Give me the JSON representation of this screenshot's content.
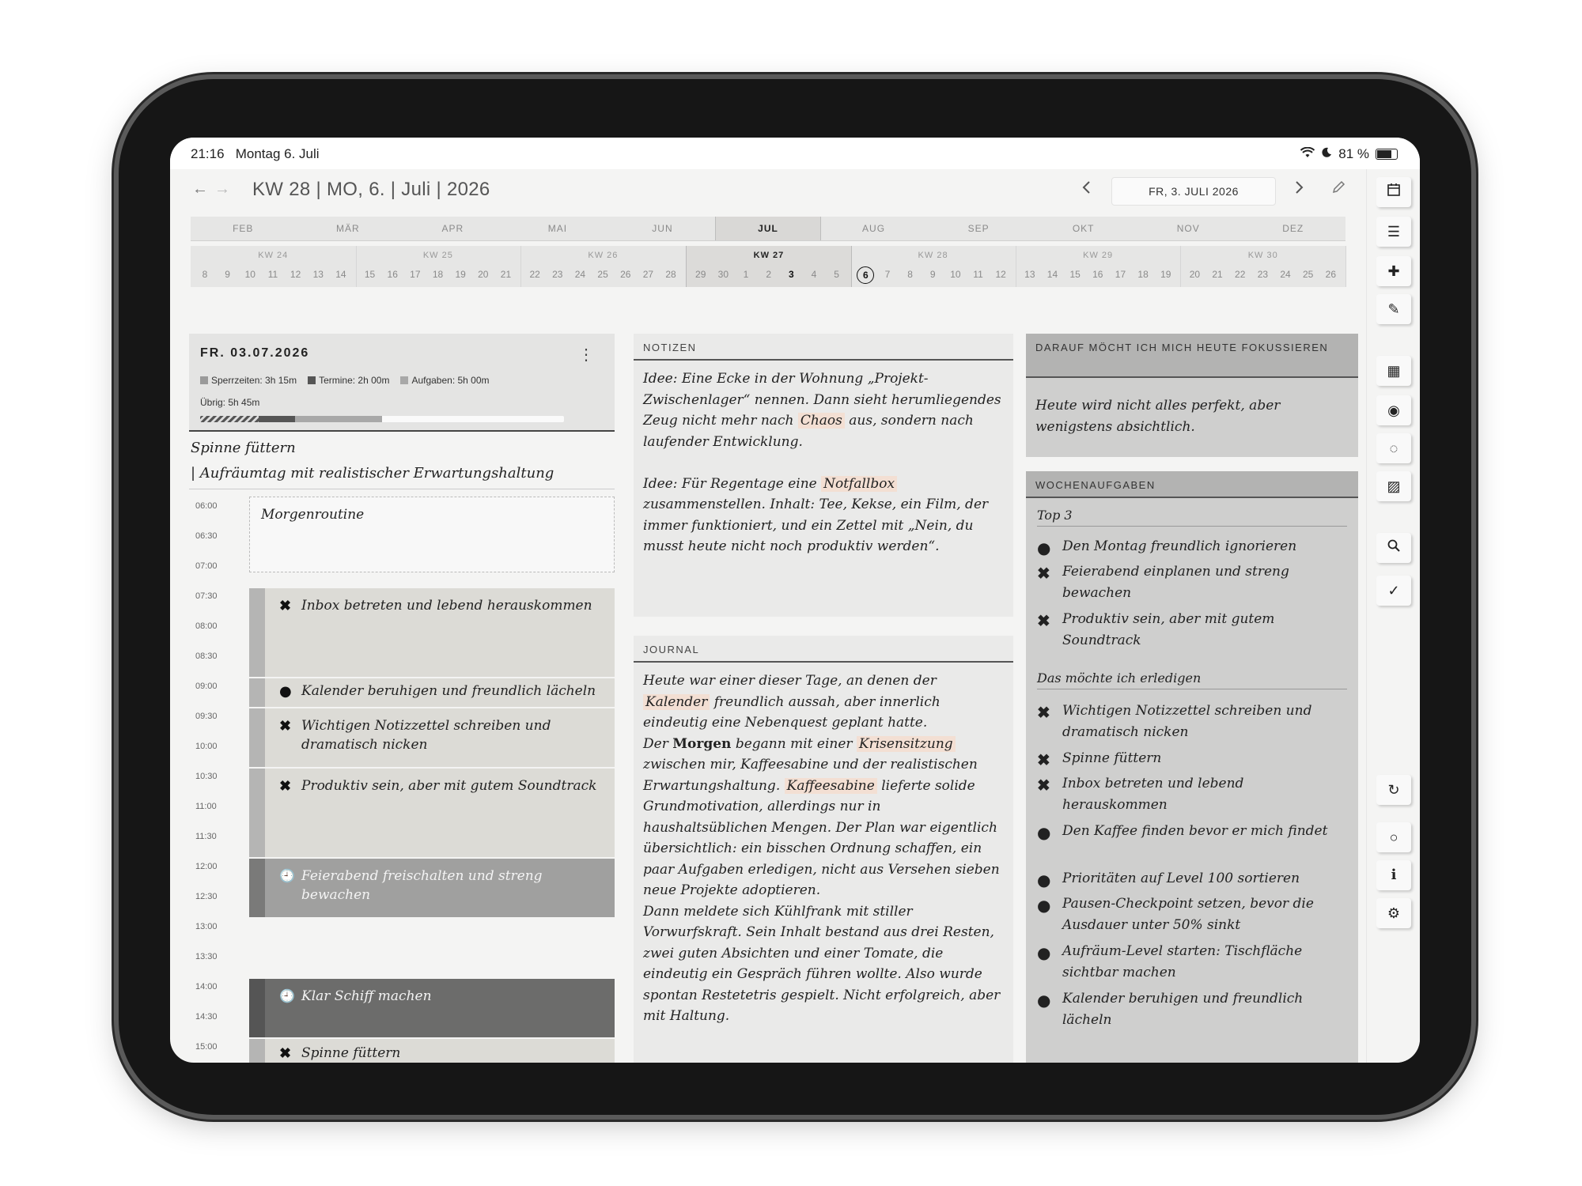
{
  "status": {
    "time": "21:16",
    "date": "Montag 6. Juli",
    "battery": "81 %"
  },
  "header": {
    "title": "KW 28 | MO, 6. | Juli | 2026",
    "selected_date": "FR, 3. JULI 2026"
  },
  "months": [
    {
      "label": "FEB"
    },
    {
      "label": "MÄR"
    },
    {
      "label": "APR"
    },
    {
      "label": "MAI"
    },
    {
      "label": "JUN"
    },
    {
      "label": "JUL",
      "active": true
    },
    {
      "label": "AUG"
    },
    {
      "label": "SEP"
    },
    {
      "label": "OKT"
    },
    {
      "label": "NOV"
    },
    {
      "label": "DEZ"
    }
  ],
  "weeks": [
    {
      "label": "KW 24",
      "days": [
        "8",
        "9",
        "10",
        "11",
        "12",
        "13",
        "14"
      ]
    },
    {
      "label": "KW 25",
      "days": [
        "15",
        "16",
        "17",
        "18",
        "19",
        "20",
        "21"
      ]
    },
    {
      "label": "KW 26",
      "days": [
        "22",
        "23",
        "24",
        "25",
        "26",
        "27",
        "28"
      ]
    },
    {
      "label": "KW 27",
      "active": true,
      "days": [
        "29",
        "30",
        "1",
        "2",
        "3",
        "4",
        "5"
      ]
    },
    {
      "label": "KW 28",
      "days": [
        "6",
        "7",
        "8",
        "9",
        "10",
        "11",
        "12"
      ]
    },
    {
      "label": "KW 29",
      "days": [
        "13",
        "14",
        "15",
        "16",
        "17",
        "18",
        "19"
      ]
    },
    {
      "label": "KW 30",
      "days": [
        "20",
        "21",
        "22",
        "23",
        "24",
        "25",
        "26"
      ]
    }
  ],
  "calendar_marks": {
    "selected_day": "3",
    "today": "6"
  },
  "daycard": {
    "date": "FR. 03.07.2026",
    "legend": [
      {
        "label": "Sperrzeiten: 3h 15m",
        "color": "#9a9a9a"
      },
      {
        "label": "Termine: 2h 00m",
        "color": "#555555"
      },
      {
        "label": "Aufgaben: 5h 00m",
        "color": "#a8a8a8"
      }
    ],
    "remaining": "Übrig: 5h 45m"
  },
  "headlines": [
    "Spinne füttern",
    "| Aufräumtag mit realistischer Erwartungshaltung"
  ],
  "times": [
    "06:00",
    "06:30",
    "07:00",
    "07:30",
    "08:00",
    "08:30",
    "09:00",
    "09:30",
    "10:00",
    "10:30",
    "11:00",
    "11:30",
    "12:00",
    "12:30",
    "13:00",
    "13:30",
    "14:00",
    "14:30",
    "15:00"
  ],
  "schedule": [
    {
      "text": "Morgenroutine"
    },
    {
      "mark": "✖",
      "text": "Inbox betreten und lebend herauskommen"
    },
    {
      "mark": "●",
      "text": "Kalender beruhigen und freundlich lächeln"
    },
    {
      "mark": "✖",
      "text": "Wichtigen Notizzettel schreiben und dramatisch nicken"
    },
    {
      "mark": "✖",
      "text": "Produktiv sein, aber mit gutem Soundtrack"
    },
    {
      "mark": "🕘",
      "text": "Feierabend freischalten und streng bewachen"
    },
    {
      "mark": "🕘",
      "text": "Klar Schiff machen"
    },
    {
      "mark": "✖",
      "text": "Spinne füttern"
    }
  ],
  "notes": {
    "header": "NOTIZEN",
    "p1": {
      "a": "Idee: Eine Ecke in der Wohnung „Projekt-Zwischenlager“ nennen. Dann sieht herumliegendes Zeug nicht mehr nach ",
      "hl": "Chaos",
      "b": " aus, sondern nach laufender Entwicklung."
    },
    "p2": {
      "a": "Idee: Für Regentage eine ",
      "hl": "Notfallbox",
      "b": " zusammenstellen. Inhalt: Tee, Kekse, ein Film, der immer funktioniert, und ein Zettel mit „Nein, du musst heute nicht noch produktiv werden“."
    }
  },
  "journal": {
    "header": "JOURNAL",
    "s1": "Heute war einer dieser Tage, an denen der ",
    "h1": "Kalender",
    "s2": " freundlich aussah, aber innerlich eindeutig eine Nebenquest geplant hatte.",
    "s3": "Der ",
    "b1": "Morgen",
    "s4": " begann mit einer ",
    "h2": "Krisensitzung",
    "s5": " zwischen mir, Kaffeesabine und der realistischen Erwartungshaltung. ",
    "h3": "Kaffeesabine",
    "s6": " lieferte solide Grundmotivation, allerdings nur in haushaltsüblichen Mengen. Der Plan war eigentlich übersichtlich: ein bisschen Ordnung schaffen, ein paar Aufgaben erledigen, nicht aus Versehen sieben neue Projekte adoptieren.",
    "s7": "Dann meldete sich Kühlfrank mit stiller Vorwurfskraft. Sein Inhalt bestand aus drei Resten, zwei guten Absichten und einer Tomate, die eindeutig ein Gespräch führen wollte. Also wurde spontan Restetetris gespielt. Nicht erfolgreich, aber mit Haltung."
  },
  "focus": {
    "header": "DARAUF MÖCHT ICH MICH HEUTE FOKUSSIEREN",
    "text": "Heute wird nicht alles perfekt, aber wenigstens absichtlich."
  },
  "weekly": {
    "header": "WOCHENAUFGABEN",
    "top_label": "Top 3",
    "top": [
      {
        "mark": "●",
        "text": "Den Montag freundlich ignorieren"
      },
      {
        "mark": "✖",
        "text": "Feierabend einplanen und streng bewachen"
      },
      {
        "mark": "✖",
        "text": "Produktiv sein, aber mit gutem Soundtrack"
      }
    ],
    "todo_label": "Das möchte ich erledigen",
    "todo": [
      {
        "mark": "✖",
        "text": "Wichtigen Notizzettel schreiben und dramatisch nicken"
      },
      {
        "mark": "✖",
        "text": "Spinne füttern"
      },
      {
        "mark": "✖",
        "text": "Inbox betreten und lebend herauskommen"
      },
      {
        "mark": "●",
        "text": "Den Kaffee finden bevor er mich findet"
      },
      {
        "mark": "●",
        "text": "Prioritäten auf Level 100 sortieren"
      },
      {
        "mark": "●",
        "text": "Pausen-Checkpoint setzen, bevor die Ausdauer unter 50% sinkt"
      },
      {
        "mark": "●",
        "text": "Aufräum-Level starten: Tischfläche sichtbar machen"
      },
      {
        "mark": "●",
        "text": "Kalender beruhigen und freundlich lächeln"
      }
    ]
  },
  "progress": {
    "hatched": 0.16,
    "dark": 0.1,
    "light": 0.24
  }
}
